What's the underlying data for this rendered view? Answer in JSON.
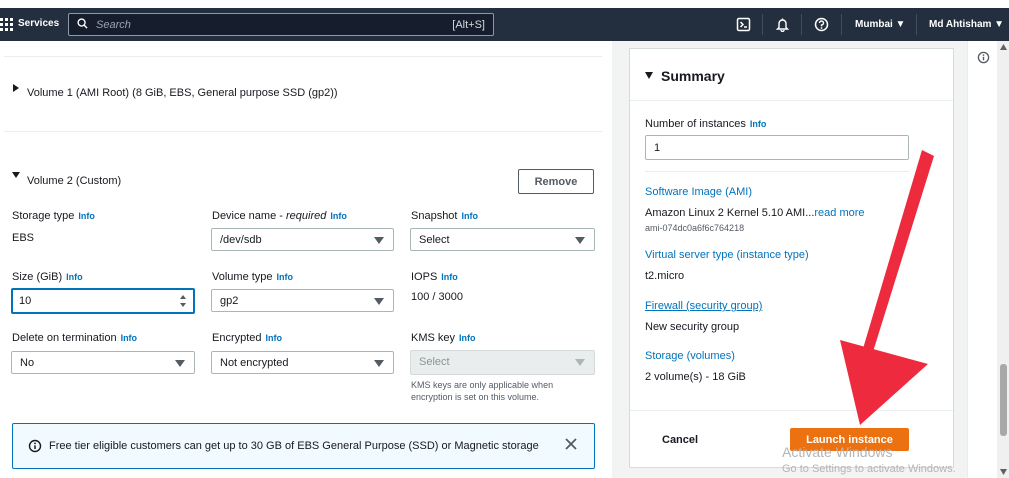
{
  "nav": {
    "services": "Services",
    "search_placeholder": "Search",
    "search_shortcut": "[Alt+S]",
    "region": "Mumbai ▼",
    "user": "Md Ahtisham ▼"
  },
  "volume1": {
    "label": "Volume 1 (AMI Root) (8 GiB, EBS, General purpose SSD (gp2))"
  },
  "volume2": {
    "label": "Volume 2 (Custom)",
    "remove": "Remove",
    "storage_type_label": "Storage type",
    "storage_type_value": "EBS",
    "device_name_label": "Device name - ",
    "device_name_required": "required",
    "device_name_value": "/dev/sdb",
    "snapshot_label": "Snapshot",
    "snapshot_value": "Select",
    "size_label": "Size (GiB)",
    "size_value": "10",
    "volume_type_label": "Volume type",
    "volume_type_value": "gp2",
    "iops_label": "IOPS",
    "iops_value": "100 / 3000",
    "delete_label": "Delete on termination",
    "delete_value": "No",
    "encrypted_label": "Encrypted",
    "encrypted_value": "Not encrypted",
    "kms_label": "KMS key",
    "kms_value": "Select",
    "kms_note_1": "KMS keys are only applicable when",
    "kms_note_2": "encryption is set on this volume."
  },
  "info": "Info",
  "alert": {
    "message": "Free tier eligible customers can get up to 30 GB of EBS General Purpose (SSD) or Magnetic storage"
  },
  "summary": {
    "title": "Summary",
    "num_instances_label": "Number of instances",
    "num_instances_value": "1",
    "ami_label": "Software Image (AMI)",
    "ami_value": "Amazon Linux 2 Kernel 5.10 AMI...",
    "ami_read_more": "read more",
    "ami_id": "ami-074dc0a6f6c764218",
    "instance_type_label": "Virtual server type (instance type)",
    "instance_type_value": "t2.micro",
    "firewall_label": "Firewall (security group)",
    "firewall_value": "New security group",
    "storage_label": "Storage (volumes)",
    "storage_value": "2 volume(s) - 18 GiB",
    "cancel": "Cancel",
    "launch": "Launch instance"
  },
  "watermark": {
    "line1": "Activate Windows",
    "line2": "Go to Settings to activate Windows."
  },
  "colors": {
    "nav_bg": "#232f3e",
    "accent": "#ec7211",
    "link": "#0073bb",
    "arrow": "#ee2b3e"
  }
}
